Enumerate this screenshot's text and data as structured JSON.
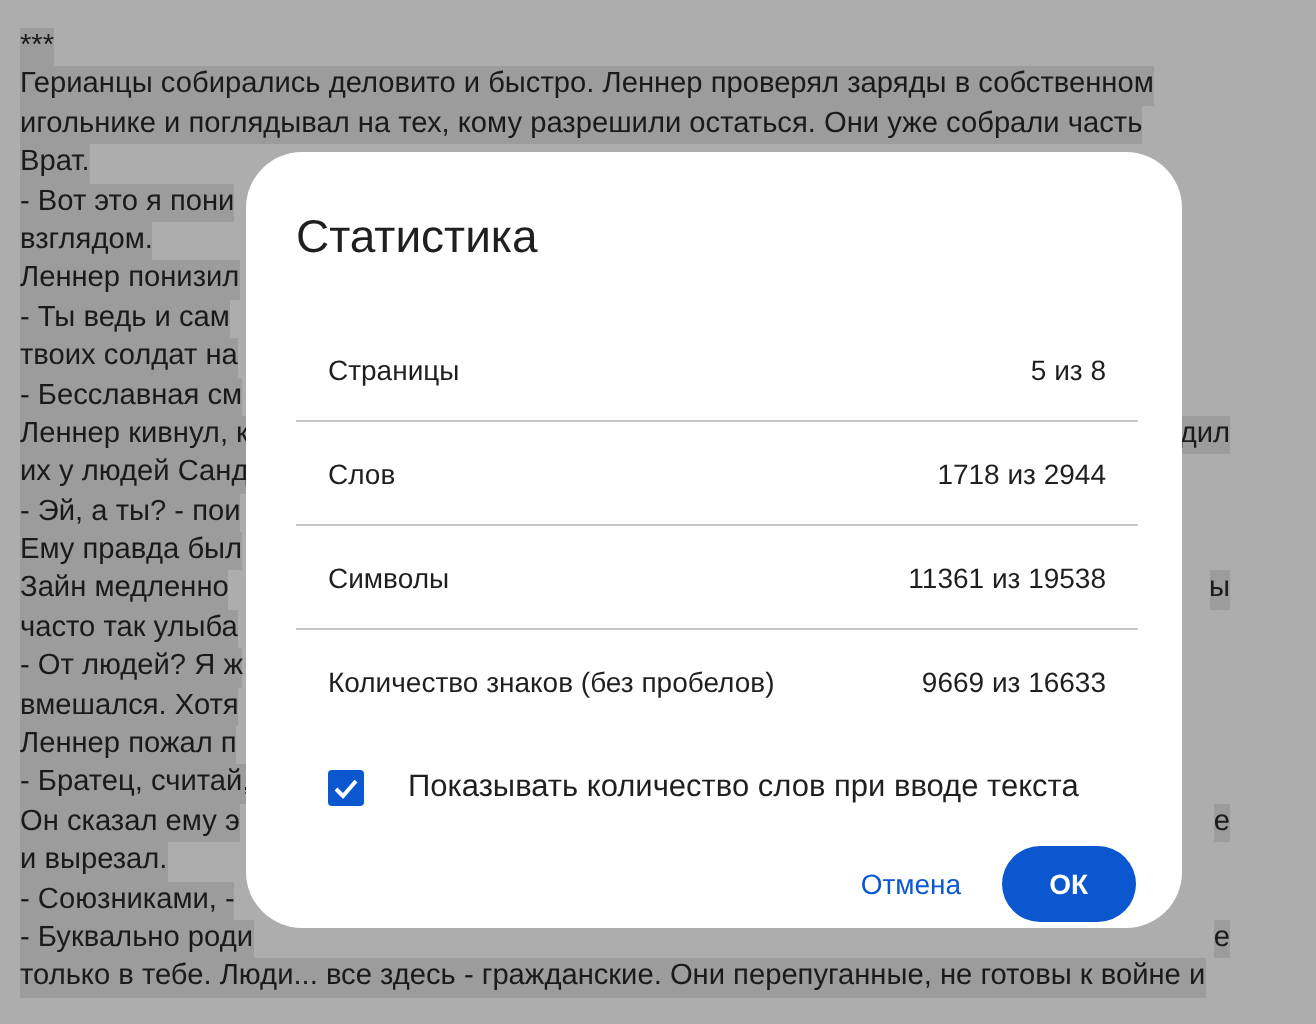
{
  "document": {
    "lines": [
      {
        "left": "***"
      },
      {
        "left": "Герианцы собирались деловито и быстро. Леннер проверял заряды в собственном"
      },
      {
        "left": "игольнике и поглядывал на тех, кому разрешили остаться. Они уже собрали часть"
      },
      {
        "left": "Врат."
      },
      {
        "left": "- Вот это я пони"
      },
      {
        "left": "взглядом."
      },
      {
        "left": "Леннер понизил"
      },
      {
        "left": "- Ты ведь и сам"
      },
      {
        "left": "твоих солдат на"
      },
      {
        "left": "- Бесславная см"
      },
      {
        "left": "Леннер кивнул, к",
        "right": "дил"
      },
      {
        "left": "их у людей Санд"
      },
      {
        "left": "- Эй, а ты? - пои"
      },
      {
        "left": "Ему правда был"
      },
      {
        "left": "Зайн медленно",
        "right": "ы"
      },
      {
        "left": "часто так улыба"
      },
      {
        "left": "- От людей? Я ж"
      },
      {
        "left": "вмешался. Хотя"
      },
      {
        "left": "Леннер пожал п"
      },
      {
        "left": "- Братец, считай,"
      },
      {
        "left": "Он сказал ему э",
        "right": "е"
      },
      {
        "left": "и вырезал."
      },
      {
        "left": "- Союзниками, -"
      },
      {
        "left": "- Буквально роди",
        "right": "е"
      },
      {
        "left": "только в тебе. Люди... все здесь - гражданские. Они перепуганные, не готовы к войне и"
      }
    ]
  },
  "dialog": {
    "title": "Статистика",
    "rows": [
      {
        "label": "Страницы",
        "value": "5 из 8"
      },
      {
        "label": "Слов",
        "value": "1718 из 2944"
      },
      {
        "label": "Символы",
        "value": "11361 из 19538"
      },
      {
        "label": "Количество знаков (без пробелов)",
        "value": "9669 из 16633"
      }
    ],
    "checkbox": {
      "label": "Показывать количество слов при вводе текста",
      "checked": true
    },
    "buttons": [
      {
        "label": "Отмена",
        "kind": "text"
      },
      {
        "label": "ОК",
        "kind": "primary"
      }
    ]
  }
}
